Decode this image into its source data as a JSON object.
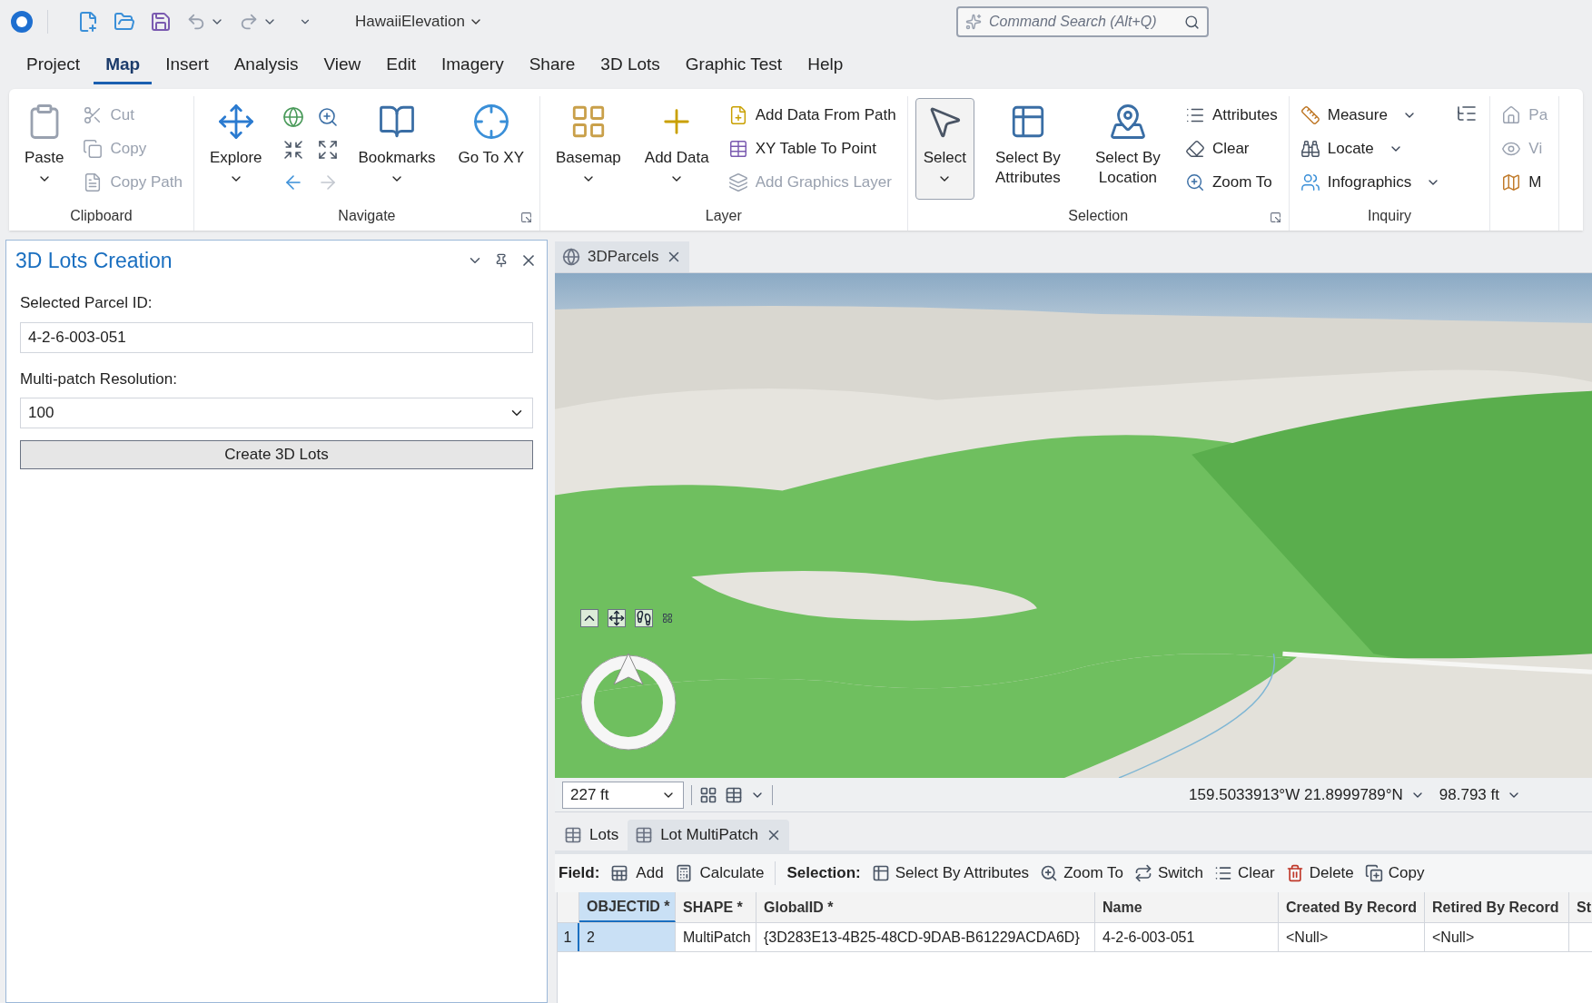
{
  "title_bar": {
    "project_name": "HawaiiElevation",
    "search": {
      "placeholder": "Command Search (Alt+Q)"
    }
  },
  "menu_tabs": [
    {
      "label": "Project",
      "selected": false
    },
    {
      "label": "Map",
      "selected": true
    },
    {
      "label": "Insert",
      "selected": false
    },
    {
      "label": "Analysis",
      "selected": false
    },
    {
      "label": "View",
      "selected": false
    },
    {
      "label": "Edit",
      "selected": false
    },
    {
      "label": "Imagery",
      "selected": false
    },
    {
      "label": "Share",
      "selected": false
    },
    {
      "label": "3D Lots",
      "selected": false
    },
    {
      "label": "Graphic Test",
      "selected": false
    },
    {
      "label": "Help",
      "selected": false
    }
  ],
  "ribbon": [
    {
      "label": "Clipboard",
      "launcher": false,
      "columns": [
        [
          {
            "kind": "large",
            "label": "Paste",
            "dropdown": true,
            "disabled": false,
            "selected": false
          }
        ],
        [
          {
            "kind": "small",
            "label": "Cut",
            "dropdown": false,
            "disabled": true
          },
          {
            "kind": "small",
            "label": "Copy",
            "dropdown": false,
            "disabled": true
          },
          {
            "kind": "small",
            "label": "Copy Path",
            "dropdown": false,
            "disabled": true
          }
        ]
      ]
    },
    {
      "label": "Navigate",
      "launcher": true,
      "columns": [
        [
          {
            "kind": "large",
            "label": "Explore",
            "dropdown": true,
            "disabled": false,
            "selected": false
          }
        ],
        [
          {
            "kind": "icon",
            "disabled": false
          },
          {
            "kind": "icon",
            "disabled": false
          },
          {
            "kind": "icon",
            "disabled": false
          },
          {
            "kind": "icon",
            "disabled": false
          },
          {
            "kind": "icon",
            "disabled": false
          },
          {
            "kind": "icon",
            "disabled": true
          }
        ],
        [
          {
            "kind": "large",
            "label": "Bookmarks",
            "dropdown": true,
            "disabled": false,
            "selected": false
          }
        ],
        [
          {
            "kind": "large",
            "label": "Go To XY",
            "dropdown": false,
            "disabled": false,
            "selected": false
          }
        ]
      ]
    },
    {
      "label": "Layer",
      "launcher": false,
      "columns": [
        [
          {
            "kind": "large",
            "label": "Basemap",
            "dropdown": true,
            "disabled": false,
            "selected": false
          }
        ],
        [
          {
            "kind": "large",
            "label": "Add Data",
            "dropdown": true,
            "disabled": false,
            "selected": false
          }
        ],
        [
          {
            "kind": "small",
            "label": "Add Data From Path",
            "dropdown": false,
            "disabled": false
          },
          {
            "kind": "small",
            "label": "XY Table To Point",
            "dropdown": false,
            "disabled": false
          },
          {
            "kind": "small",
            "label": "Add Graphics Layer",
            "dropdown": false,
            "disabled": true
          }
        ]
      ]
    },
    {
      "label": "Selection",
      "launcher": true,
      "columns": [
        [
          {
            "kind": "large",
            "label": "Select",
            "dropdown": true,
            "disabled": false,
            "selected": true
          }
        ],
        [
          {
            "kind": "large",
            "label": "Select By Attributes",
            "dropdown": false,
            "disabled": false,
            "selected": false
          }
        ],
        [
          {
            "kind": "large",
            "label": "Select By Location",
            "dropdown": false,
            "disabled": false,
            "selected": false
          }
        ],
        [
          {
            "kind": "small",
            "label": "Attributes",
            "dropdown": false,
            "disabled": false
          },
          {
            "kind": "small",
            "label": "Clear",
            "dropdown": false,
            "disabled": false
          },
          {
            "kind": "small",
            "label": "Zoom To",
            "dropdown": false,
            "disabled": false
          }
        ]
      ]
    },
    {
      "label": "Inquiry",
      "launcher": false,
      "columns": [
        [
          {
            "kind": "small",
            "label": "Measure",
            "dropdown": true,
            "disabled": false
          },
          {
            "kind": "small",
            "label": "Locate",
            "dropdown": true,
            "disabled": false
          },
          {
            "kind": "small",
            "label": "Infographics",
            "dropdown": true,
            "disabled": false
          }
        ],
        [
          {
            "kind": "icon",
            "disabled": false
          }
        ]
      ]
    },
    {
      "launcher": false,
      "columns": [
        [
          {
            "kind": "small",
            "label": "Pa",
            "dropdown": false,
            "disabled": true
          },
          {
            "kind": "small",
            "label": "Vi",
            "dropdown": false,
            "disabled": true
          },
          {
            "kind": "small",
            "label": "M",
            "dropdown": false,
            "disabled": false
          }
        ]
      ]
    }
  ],
  "pane": {
    "title": "3D Lots Creation",
    "parcel_label": "Selected Parcel ID:",
    "parcel_value": "4-2-6-003-051",
    "resolution_label": "Multi-patch Resolution:",
    "resolution_value": "100",
    "button": "Create 3D Lots"
  },
  "map_view": {
    "tab": {
      "label": "3DParcels",
      "selected": true
    },
    "scale": "227 ft",
    "coordinates": "159.5033913°W 21.8999789°N",
    "elevation": "98.793 ft"
  },
  "table_tabs": [
    {
      "label": "Lots",
      "selected": false,
      "closable": false
    },
    {
      "label": "Lot MultiPatch",
      "selected": true,
      "closable": true
    }
  ],
  "table_toolbar": {
    "field_label": "Field:",
    "field_buttons": [
      "Add",
      "Calculate"
    ],
    "selection_label": "Selection:",
    "selection_buttons": [
      "Select By Attributes",
      "Zoom To",
      "Switch",
      "Clear",
      "Delete",
      "Copy"
    ]
  },
  "table": {
    "columns": [
      "OBJECTID *",
      "SHAPE *",
      "GlobalID *",
      "Name",
      "Created By Record",
      "Retired By Record",
      "St"
    ],
    "rows": [
      {
        "number": "1",
        "selected": true,
        "cells": [
          "2",
          "MultiPatch",
          "{3D283E13-4B25-48CD-9DAB-B61229ACDA6D}",
          "4-2-6-003-051",
          "<Null>",
          "<Null>"
        ]
      }
    ]
  }
}
